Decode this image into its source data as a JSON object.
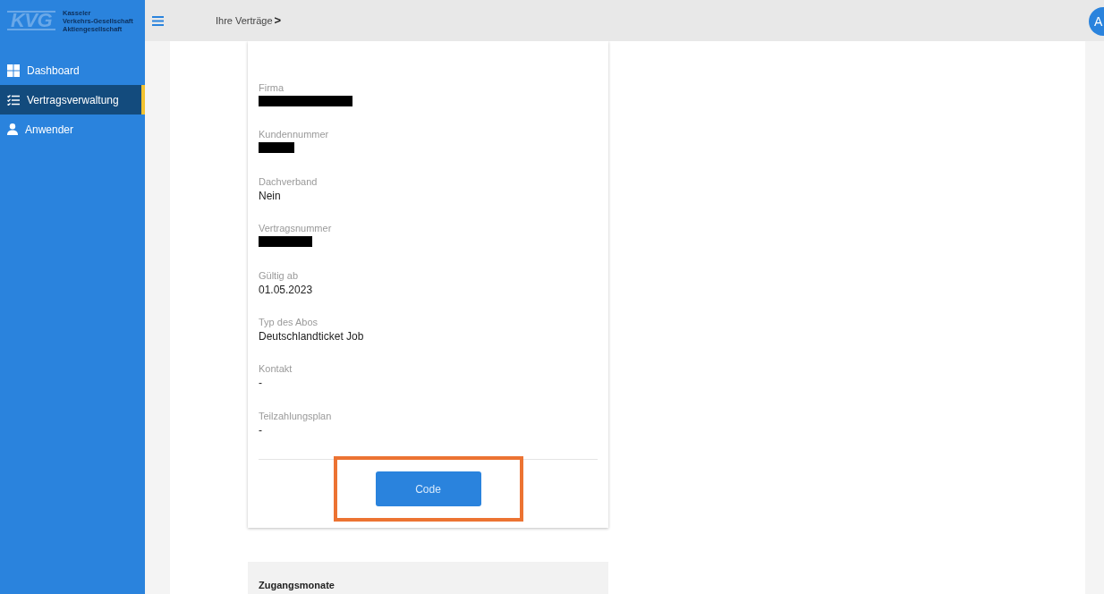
{
  "logo": {
    "mark": "KVG",
    "lines": [
      "Kasseler",
      "Verkehrs-Gesellschaft",
      "Aktiengesellschaft"
    ]
  },
  "sidebar": {
    "items": [
      {
        "label": "Dashboard",
        "selected": false
      },
      {
        "label": "Vertragsverwaltung",
        "selected": true
      },
      {
        "label": "Anwender",
        "selected": false
      }
    ]
  },
  "header": {
    "breadcrumb": "Ihre Verträge",
    "chevron": ">",
    "avatar": "A"
  },
  "contract": {
    "fields": [
      {
        "label": "Firma",
        "redacted": true
      },
      {
        "label": "Kundennummer",
        "redacted": true
      },
      {
        "label": "Dachverband",
        "value": "Nein"
      },
      {
        "label": "Vertragsnummer",
        "redacted": true
      },
      {
        "label": "Gültig ab",
        "value": "01.05.2023"
      },
      {
        "label": "Typ des Abos",
        "value": "Deutschlandticket Job"
      },
      {
        "label": "Kontakt",
        "value": "-"
      },
      {
        "label": "Teilzahlungsplan",
        "value": "-"
      }
    ],
    "button": {
      "label": "Code",
      "highlighted": true
    }
  },
  "section": {
    "title": "Zugangsmonate"
  }
}
